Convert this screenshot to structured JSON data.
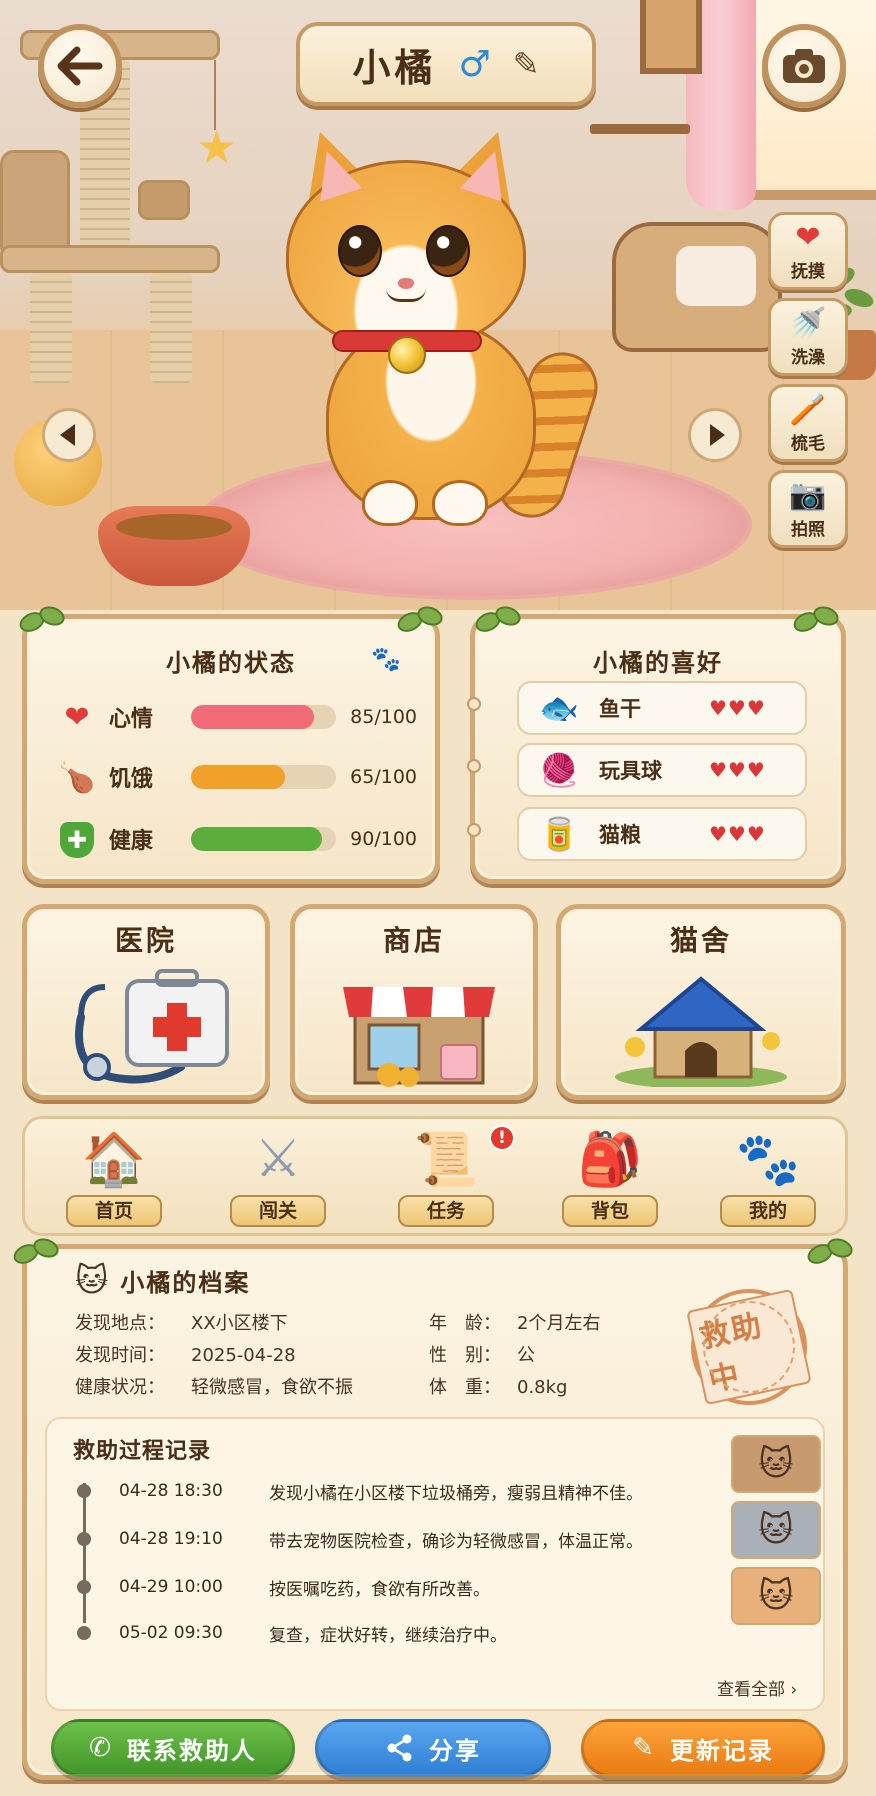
{
  "header": {
    "cat_name": "小橘",
    "gender_symbol": "♂",
    "edit_icon": "pencil-icon",
    "back_icon": "back-arrow-icon",
    "camera_icon": "camera-icon"
  },
  "side_actions": [
    {
      "label": "抚摸",
      "icon": "heart-icon",
      "glyph": "❤"
    },
    {
      "label": "洗澡",
      "icon": "shower-icon",
      "glyph": "🚿"
    },
    {
      "label": "梳毛",
      "icon": "brush-icon",
      "glyph": "🪥"
    },
    {
      "label": "拍照",
      "icon": "camera-icon",
      "glyph": "📷"
    }
  ],
  "status": {
    "title": "小橘的状态",
    "items": [
      {
        "label": "心情",
        "value": 85,
        "max": 100,
        "text": "85/100",
        "color": "#f06a78",
        "icon": "heart-icon",
        "glyph": "❤"
      },
      {
        "label": "饥饿",
        "value": 65,
        "max": 100,
        "text": "65/100",
        "color": "#f1a02a",
        "icon": "drumstick-icon",
        "glyph": "🍗"
      },
      {
        "label": "健康",
        "value": 90,
        "max": 100,
        "text": "90/100",
        "color": "#5cae3c",
        "icon": "health-shield-icon",
        "glyph": "✚"
      }
    ]
  },
  "likes": {
    "title": "小橘的喜好",
    "items": [
      {
        "label": "鱼干",
        "hearts": "♥♥♥",
        "icon": "fish-icon",
        "glyph": "🐟"
      },
      {
        "label": "玩具球",
        "hearts": "♥♥♥",
        "icon": "yarn-ball-icon",
        "glyph": "🧶"
      },
      {
        "label": "猫粮",
        "hearts": "♥♥♥",
        "icon": "cat-food-can-icon",
        "glyph": "🥫"
      }
    ]
  },
  "places": [
    {
      "label": "医院",
      "icon": "first-aid-kit-icon"
    },
    {
      "label": "商店",
      "icon": "shop-icon"
    },
    {
      "label": "猫舍",
      "icon": "cat-house-icon"
    }
  ],
  "nav": [
    {
      "label": "首页",
      "icon": "home-icon",
      "glyph": "🏠"
    },
    {
      "label": "闯关",
      "icon": "crossed-swords-icon",
      "glyph": "⚔"
    },
    {
      "label": "任务",
      "icon": "scroll-icon",
      "glyph": "📜",
      "badge": "!"
    },
    {
      "label": "背包",
      "icon": "backpack-icon",
      "glyph": "🎒"
    },
    {
      "label": "我的",
      "icon": "paw-icon",
      "glyph": "🐾"
    }
  ],
  "archive": {
    "title": "小橘的档案",
    "fields": [
      {
        "key": "发现地点：",
        "value": "XX小区楼下"
      },
      {
        "key": "发现时间：",
        "value": "2025-04-28"
      },
      {
        "key": "健康状况：",
        "value": "轻微感冒，食欲不振"
      },
      {
        "key": "年　龄：",
        "value": "2个月左右"
      },
      {
        "key": "性　别：",
        "value": "公"
      },
      {
        "key": "体　重：",
        "value": "0.8kg"
      }
    ],
    "stamp": "救助中",
    "timeline_title": "救助过程记录",
    "timeline": [
      {
        "time": "04-28  18:30",
        "text": "发现小橘在小区楼下垃圾桶旁，瘦弱且精神不佳。"
      },
      {
        "time": "04-28  19:10",
        "text": "带去宠物医院检查，确诊为轻微感冒，体温正常。"
      },
      {
        "time": "04-29  10:00",
        "text": "按医嘱吃药，食欲有所改善。"
      },
      {
        "time": "05-02  09:30",
        "text": "复查，症状好转，继续治疗中。"
      }
    ],
    "view_all": "查看全部 ›"
  },
  "actions": {
    "contact": "联系救助人",
    "share": "分享",
    "update": "更新记录"
  }
}
